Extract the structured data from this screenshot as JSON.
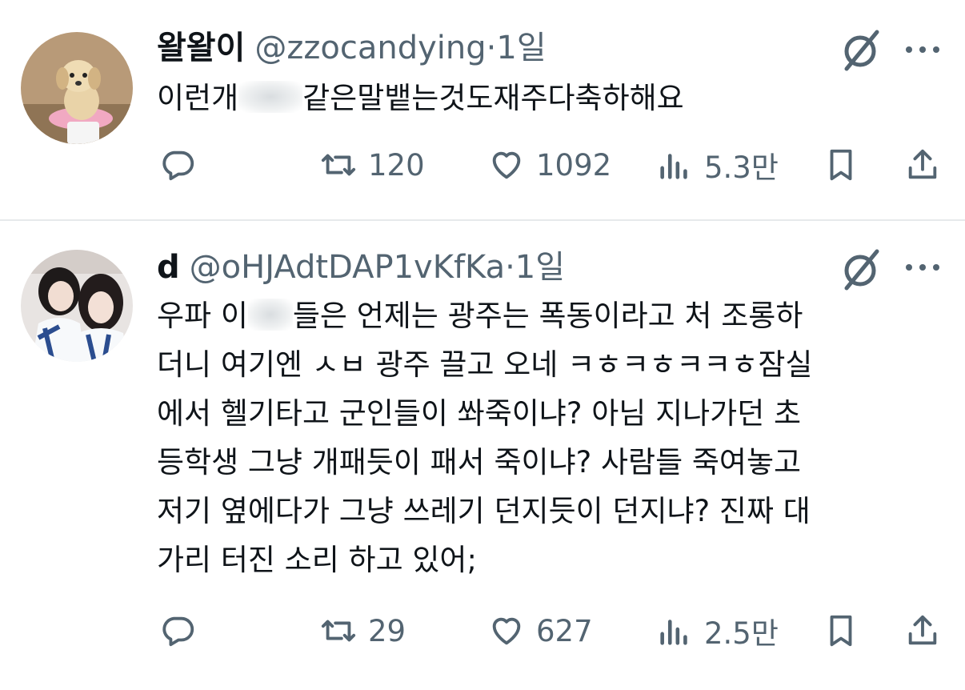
{
  "tweets": [
    {
      "name": "왈왈이",
      "handle": "@zzocandying",
      "separator": "·",
      "time": "1일",
      "text_lines": [
        {
          "pre": "이런개",
          "post": "같은말뱉는것도재주다축하해요"
        }
      ],
      "stats": {
        "retweets": "120",
        "likes": "1092",
        "views": "5.3만"
      },
      "avatar_icon": "puppy-avatar"
    },
    {
      "name": "d",
      "handle": "@oHJAdtDAP1vKfKa",
      "separator": "·",
      "time": "1일",
      "text_lines": [
        {
          "pre": "우파 이",
          "post": "들은 언제는 광주는 폭동이라고 처 조롱하"
        },
        {
          "pre": "더니 여기엔 ㅅㅂ 광주 끌고 오네 ㅋㅎㅋㅎㅋㅋㅎ잠실",
          "post": ""
        },
        {
          "pre": "에서 헬기타고 군인들이 쏴죽이냐? 아님 지나가던 초",
          "post": ""
        },
        {
          "pre": "등학생 그냥 개패듯이 패서 죽이냐? 사람들 죽여놓고",
          "post": ""
        },
        {
          "pre": "저기 옆에다가 그냥 쓰레기 던지듯이 던지냐? 진짜 대",
          "post": ""
        },
        {
          "pre": "가리 터진 소리 하고 있어;",
          "post": ""
        }
      ],
      "stats": {
        "retweets": "29",
        "likes": "627",
        "views": "2.5만"
      },
      "avatar_icon": "two-people-avatar"
    }
  ],
  "colors": {
    "text": "#0f1419",
    "muted": "#536471",
    "divider": "#e6e9eb"
  },
  "icons": [
    "reply-icon",
    "retweet-icon",
    "like-icon",
    "views-icon",
    "bookmark-icon",
    "share-icon",
    "grok-icon",
    "more-icon"
  ]
}
